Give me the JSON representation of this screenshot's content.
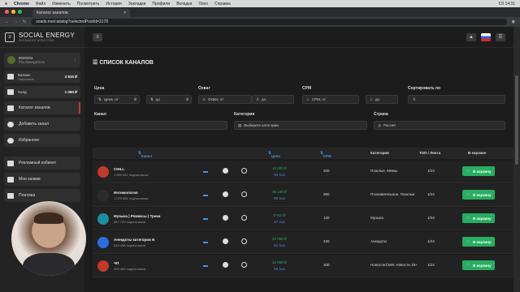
{
  "mac_menu": {
    "app": "Chrome",
    "items": [
      "Файл",
      "Изменить",
      "Посмотреть",
      "История",
      "Закладки",
      "Профили",
      "Вкладка",
      "Окно",
      "Справка"
    ],
    "time": "Сб 14:31"
  },
  "browser": {
    "tab_title": "Каталог каналов",
    "url": "soads.me/catalog?selectedPostId=3178"
  },
  "brand": {
    "name": "SOCIAL ENERGY",
    "tagline": "РЕКЛАМНОЕ АГЕНТСТВО"
  },
  "user": {
    "id": "6040404",
    "role": "Рекламодатель"
  },
  "balance": [
    {
      "label": "Баланс",
      "sub": "Пополнить",
      "value": "3 815 ₽"
    },
    {
      "label": "Холд",
      "sub": "",
      "value": "1 090 ₽"
    }
  ],
  "nav": [
    {
      "label": "Каталог каналов",
      "icon": "list-icon"
    },
    {
      "label": "Добавить канал",
      "icon": "plus-icon"
    },
    {
      "label": "Избранное",
      "icon": "heart-icon"
    },
    {
      "label": "Рекламный кабинет",
      "icon": "cabinet-icon"
    },
    {
      "label": "Мои заявки",
      "icon": "requests-icon"
    },
    {
      "label": "Платежи",
      "icon": "card-icon"
    }
  ],
  "page_title": "СПИСОК КАНАЛОВ",
  "filters": {
    "price": {
      "label": "Цена",
      "from": "Цена, от",
      "to": "до"
    },
    "reach": {
      "label": "Охват",
      "from": "Охват, от",
      "to": "до"
    },
    "cpm": {
      "label": "CPM",
      "from": "CPM, от",
      "to": "до"
    },
    "sort": {
      "label": "Сортировать по"
    },
    "channel": {
      "label": "Канал"
    },
    "category": {
      "label": "Категория",
      "value": "Выберите категории"
    },
    "country": {
      "label": "Страна",
      "value": "Россия"
    },
    "currency": "₽"
  },
  "table": {
    "headers": {
      "channel": "Канал",
      "price": "Цена",
      "cpm": "CPM",
      "category": "Категория",
      "top": "ТОП / Лента",
      "cart": "В корзине"
    },
    "rows": [
      {
        "name": "CHILL",
        "subs": "1 850 867 подписчиков",
        "price": "10 000 ₽",
        "cpm_alt": "93 тыс",
        "cpm": "200",
        "category": "Пошлые, Мемы",
        "top": "1/24",
        "button": "В корзину",
        "color": "#c0392b"
      },
      {
        "name": "Интимология",
        "subs": "1 070 681 подписчиков",
        "price": "45 180 ₽",
        "cpm_alt": "80 тыс",
        "cpm": "360",
        "category": "Познавательное, Пошлые",
        "top": "1/24",
        "button": "В корзину",
        "color": "#2c2c2c"
      },
      {
        "name": "Музыка | Ремиксы | Треки",
        "subs": "567 720 подписчиков",
        "price": "5 910 ₽",
        "cpm_alt": "47 тыс",
        "cpm": "130",
        "category": "Музыка",
        "top": "1/24",
        "button": "В корзину",
        "color": "#1a8fa0"
      },
      {
        "name": "Анекдоты категории Б",
        "subs": "543 488 подписчиков",
        "price": "10 050 ₽",
        "cpm_alt": "51 тыс",
        "cpm": "230",
        "category": "Анекдоты",
        "top": "1/24",
        "button": "В корзину",
        "color": "#2d6cdf"
      },
      {
        "name": "ЧП",
        "subs": "489 389 подписчиков",
        "price": "10 050 ₽",
        "cpm_alt": "55 тыс",
        "cpm": "200",
        "category": "Новости/СМИ, Новости 18+",
        "top": "1/24",
        "button": "В корзину",
        "color": "#c0392b"
      }
    ]
  }
}
